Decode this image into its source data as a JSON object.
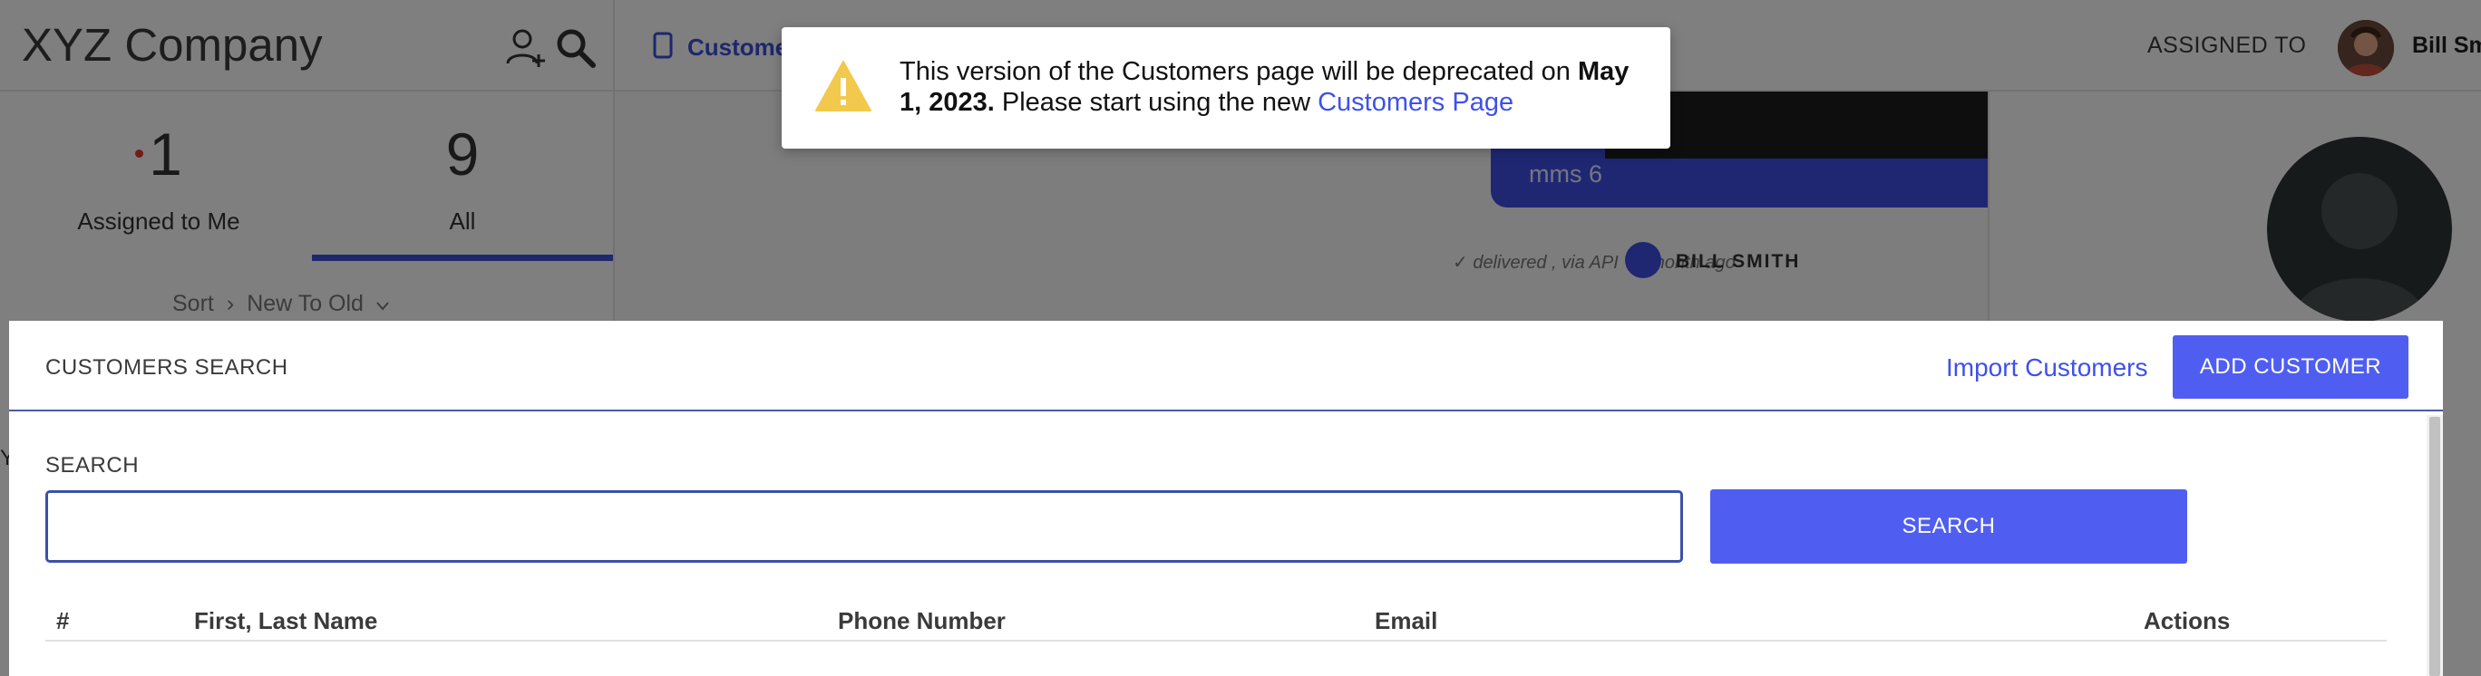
{
  "app": {
    "brand": "XYZ Company",
    "conversation_tab_label": "Customers",
    "assigned_to_label": "ASSIGNED TO",
    "user_name": "Bill Smith"
  },
  "left_panel": {
    "counters": [
      {
        "value": "1",
        "label": "Assigned to Me",
        "has_unread_dot": true
      },
      {
        "value": "9",
        "label": "All",
        "active": true
      }
    ],
    "sort_label": "Sort",
    "sort_separator": "›",
    "sort_value": "New To Old"
  },
  "chat": {
    "mms_text": "mms 6",
    "message_status": "✓  delivered , via API  ·  a month ago",
    "message_author": "BILL SMITH"
  },
  "toast": {
    "text_part1": "This version of the Customers page will be deprecated on ",
    "date_bold": "May 1, 2023.",
    "text_part2": " Please start using the new ",
    "link_text": "Customers Page",
    "icon": "warning-icon",
    "icon_color": "#f2c94c"
  },
  "modal": {
    "title": "CUSTOMERS SEARCH",
    "import_link": "Import Customers",
    "add_button": "ADD CUSTOMER",
    "search_label": "SEARCH",
    "search_value": "",
    "search_placeholder": "",
    "search_button": "SEARCH",
    "table_headers": [
      "#",
      "First, Last Name",
      "Phone Number",
      "Email",
      "Actions"
    ]
  },
  "colors": {
    "primary": "#4f5ef0",
    "link": "#3f51e8",
    "focus_border": "#3a51a8"
  }
}
